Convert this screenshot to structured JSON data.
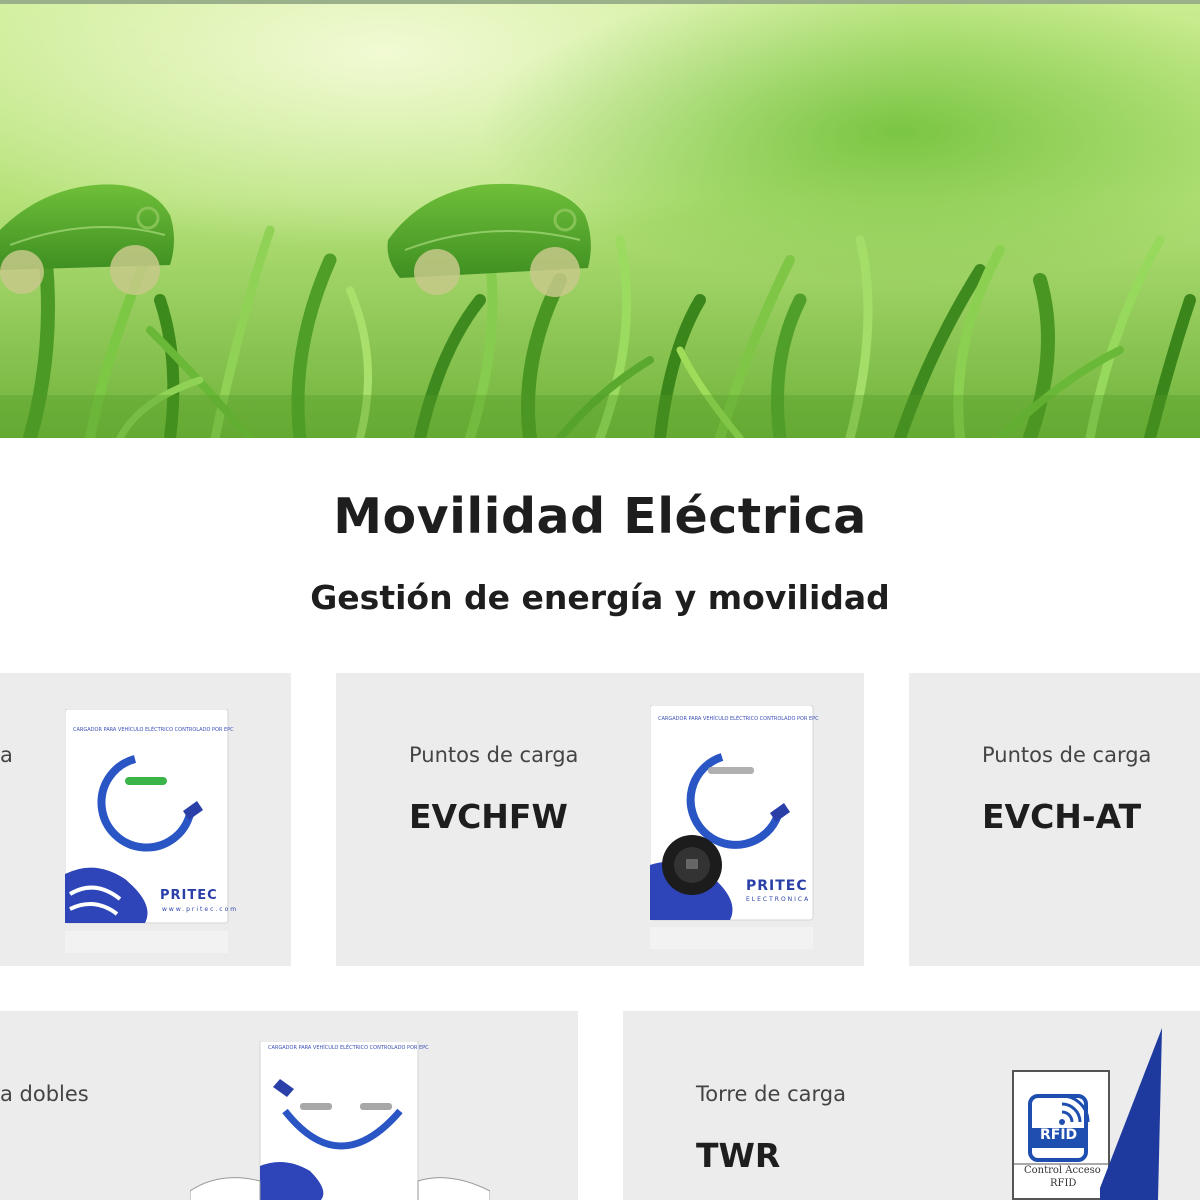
{
  "hero": {
    "background": "green grass field with leaf-shaped cars",
    "colors": {
      "sky": "#d9f0a8",
      "grass_dark": "#3f8a1e",
      "grass_light": "#9fdc5a"
    }
  },
  "section": {
    "title": "Movilidad Eléctrica",
    "subtitle": "Gestión de energía y movilidad"
  },
  "products": [
    {
      "category": "a",
      "model": ""
    },
    {
      "category": "Puntos de carga",
      "model": "EVCHFW"
    },
    {
      "category": "Puntos de carga",
      "model": "EVCH-AT"
    },
    {
      "category": "a dobles",
      "model": ""
    },
    {
      "category": "Torre de carga",
      "model": "TWR"
    }
  ],
  "charger_labels": {
    "header": "CARGADOR PARA VEHÍCULO ELÉCTRICO CONTROLADO POR EPC",
    "brand": "PRITEC",
    "brand_sub": "ELECTRONICA",
    "url": "www.pritec.com"
  },
  "rfid": {
    "badge": "RFID",
    "caption_line1": "Control Acceso",
    "caption_line2": "RFID"
  },
  "theme": {
    "card_bg": "#ececec",
    "brand_blue": "#2a3fa8",
    "text_dark": "#1e1e1e"
  }
}
